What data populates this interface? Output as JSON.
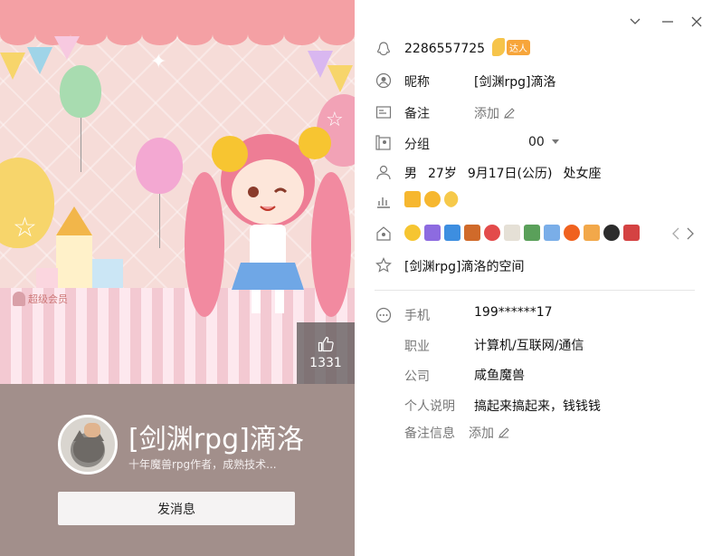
{
  "profile": {
    "vip_label": "超级会员",
    "likes": "1331",
    "name": "[剑渊rpg]滴洛",
    "description": "十年魔兽rpg作者，成熟技术...",
    "send_button": "发消息"
  },
  "info": {
    "qq_number": "2286557725",
    "talent_badge": "达人",
    "nickname_label": "昵称",
    "nickname_value": "[剑渊rpg]滴洛",
    "remark_label": "备注",
    "remark_add": "添加",
    "group_label": "分组",
    "group_value": "00",
    "gender": "男",
    "age": "27岁",
    "birthday": "9月17日(公历)",
    "zodiac": "处女座",
    "space_link": "[剑渊rpg]滴洛的空间",
    "phone_label": "手机",
    "phone_value": "199******17",
    "job_label": "职业",
    "job_value": "计算机/互联网/通信",
    "company_label": "公司",
    "company_value": "咸鱼魔兽",
    "bio_label": "个人说明",
    "bio_value": "搞起来搞起来，钱钱钱",
    "remark_info_label": "备注信息",
    "remark_info_add": "添加"
  },
  "colors": {
    "banner_bg": "#f6dcd8",
    "profile_bg": "#a28f8b",
    "accent": "#f4a0a4"
  }
}
